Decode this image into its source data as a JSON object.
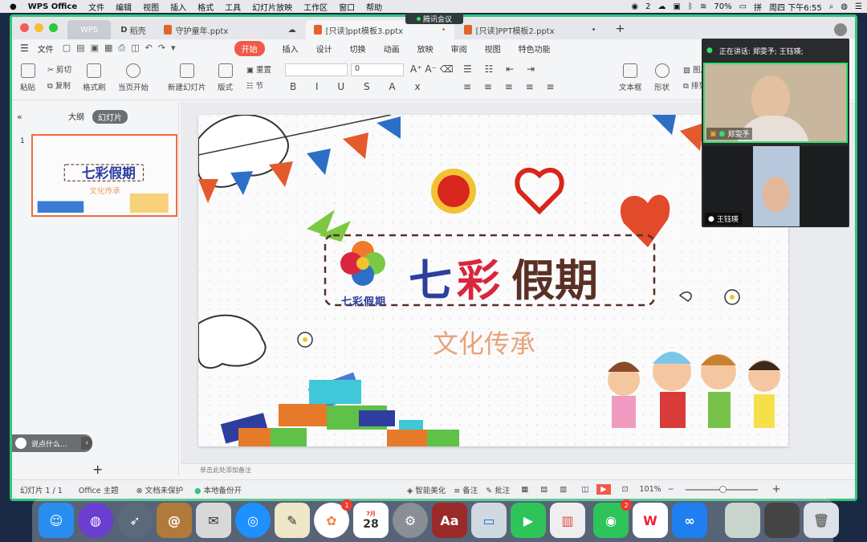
{
  "menubar": {
    "app": "WPS Office",
    "items": [
      "文件",
      "编辑",
      "视图",
      "插入",
      "格式",
      "工具",
      "幻灯片放映",
      "工作区",
      "窗口",
      "帮助"
    ],
    "wechat_count": "2",
    "battery": "70%",
    "datetime": "周四 下午6:55"
  },
  "meeting": {
    "label": "腾讯会议"
  },
  "tabs": {
    "wps": "WPS",
    "daoke": "稻壳",
    "doc1": "守护童年.pptx",
    "doc2": "[只读]ppt模板3.pptx",
    "doc3": "[只读]PPT模板2.pptx"
  },
  "menu": {
    "file": "文件",
    "items": [
      "开始",
      "插入",
      "设计",
      "切换",
      "动画",
      "放映",
      "审阅",
      "视图",
      "特色功能"
    ],
    "active": "开始"
  },
  "ribbon": {
    "paste": "粘贴",
    "cut": "剪切",
    "copy": "复制",
    "format_painter": "格式刷",
    "from_start": "当页开始",
    "new_slide": "新建幻灯片",
    "layout": "版式",
    "reset": "重置",
    "section": "节",
    "font_size": "0",
    "textbox": "文本框",
    "shape": "形状",
    "image": "图片",
    "arrange": "排列"
  },
  "leftpane": {
    "outline": "大纲",
    "slides": "幻灯片",
    "slide_number": "1",
    "chat_placeholder": "说点什么..."
  },
  "slide": {
    "title_1": "七",
    "title_2": "彩",
    "title_3": "假期",
    "subtitle": "文化传承",
    "logo_text": "七彩假期"
  },
  "notes": {
    "placeholder": "单击此处添加备注"
  },
  "status": {
    "slide_count": "幻灯片 1 / 1",
    "theme": "Office 主题",
    "protect": "文档未保护",
    "backup": "本地备份开",
    "beautify": "智能美化",
    "notes": "备注",
    "comment": "批注",
    "zoom": "101%"
  },
  "video": {
    "speaking": "正在讲话: 郑雯予; 王钰瑛;",
    "p1": "郑雯予",
    "p2": "王钰瑛"
  },
  "dock": {
    "photos_badge": "1",
    "wechat_badge": "2",
    "calendar_month": "7月",
    "calendar_day": "28"
  },
  "colors": {
    "accent": "#f05a4a",
    "window_border": "#31c57a",
    "wps_red": "#e2632c"
  }
}
